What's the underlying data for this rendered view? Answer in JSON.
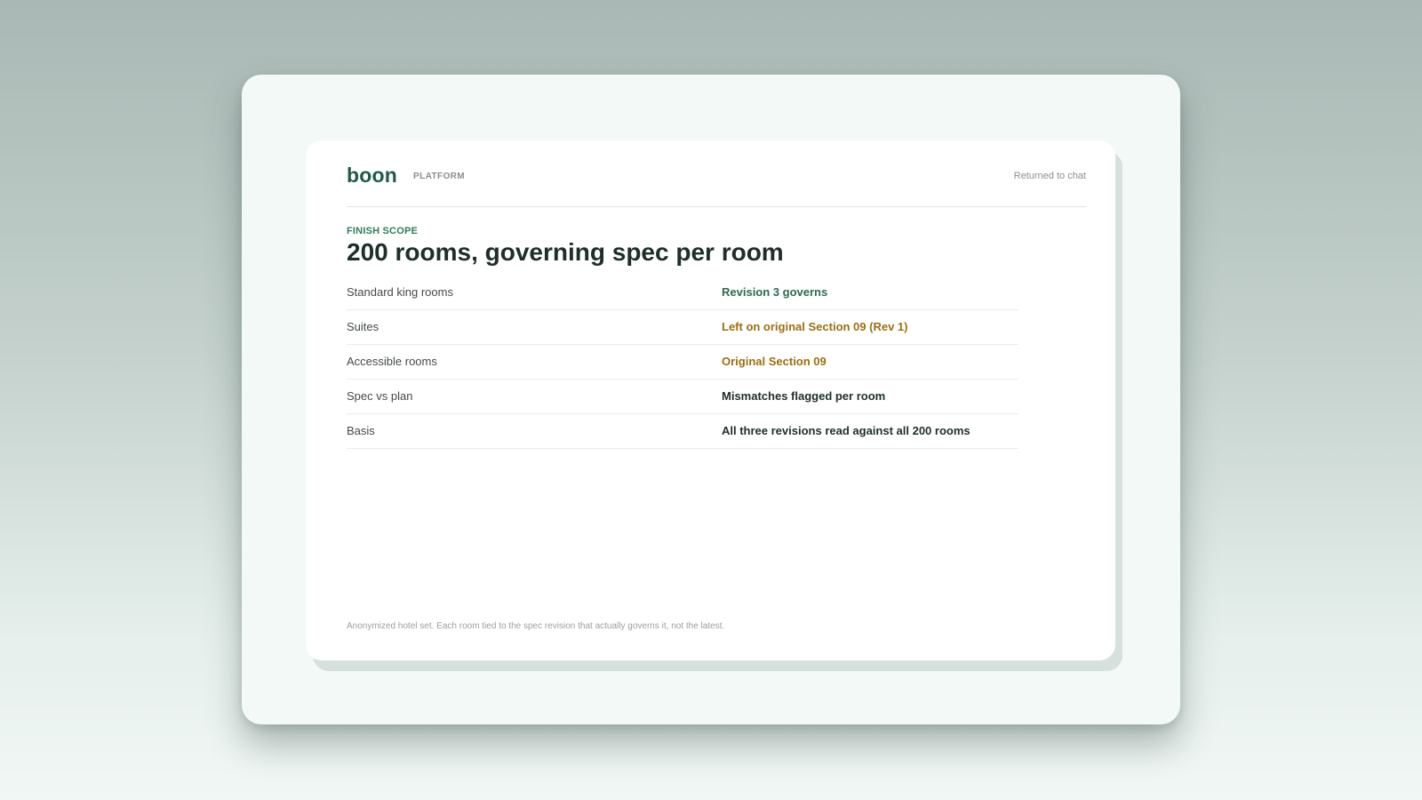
{
  "header": {
    "logo": "boon",
    "platform_label": "PLATFORM",
    "status": "Returned to chat"
  },
  "section": {
    "eyebrow": "FINISH SCOPE",
    "title": "200 rooms, governing spec per room"
  },
  "rows": [
    {
      "label": "Standard king rooms",
      "value": "Revision 3 governs",
      "color": "#2c6a4f"
    },
    {
      "label": "Suites",
      "value": "Left on original Section 09 (Rev 1)",
      "color": "#9a6f14"
    },
    {
      "label": "Accessible rooms",
      "value": "Original Section 09",
      "color": "#9a6f14"
    },
    {
      "label": "Spec vs plan",
      "value": "Mismatches flagged per room",
      "color": "#1f2e2a"
    },
    {
      "label": "Basis",
      "value": "All three revisions read against all 200 rooms",
      "color": "#1f2e2a"
    }
  ],
  "footnote": "Anonymized hotel set. Each room tied to the spec revision that actually governs it, not the latest.",
  "colors": {
    "brand": "#1f5b46",
    "eyebrow": "#2e7d5b",
    "governs": "#2c6a4f",
    "legacy": "#9a6f14",
    "neutral": "#1f2e2a"
  }
}
